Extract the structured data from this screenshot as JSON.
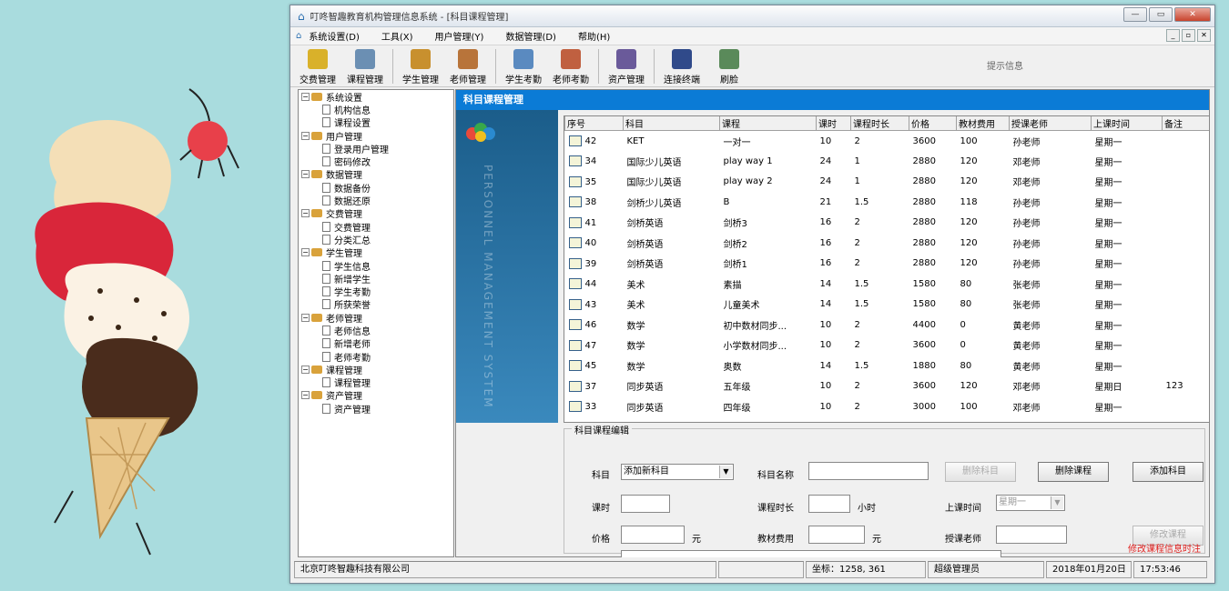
{
  "window": {
    "title": "叮咚智趣教育机构管理信息系统 - [科目课程管理]"
  },
  "menu": [
    "系统设置(D)",
    "工具(X)",
    "用户管理(Y)",
    "数据管理(D)",
    "帮助(H)"
  ],
  "toolbar": {
    "buttons": [
      {
        "label": "交费管理",
        "color": "#d9b12a"
      },
      {
        "label": "课程管理",
        "color": "#6b8fb3"
      },
      {
        "label": "学生管理",
        "color": "#c8902e"
      },
      {
        "label": "老师管理",
        "color": "#b8743a"
      },
      {
        "label": "学生考勤",
        "color": "#5a8ac0"
      },
      {
        "label": "老师考勤",
        "color": "#c06040"
      },
      {
        "label": "资产管理",
        "color": "#6a5a9a"
      },
      {
        "label": "连接终端",
        "color": "#304a8a"
      },
      {
        "label": "刷脸",
        "color": "#5a8a5a"
      }
    ],
    "tip": "提示信息"
  },
  "tree": [
    {
      "label": "系统设置",
      "children": [
        "机构信息",
        "课程设置"
      ]
    },
    {
      "label": "用户管理",
      "children": [
        "登录用户管理",
        "密码修改"
      ]
    },
    {
      "label": "数据管理",
      "children": [
        "数据备份",
        "数据还原"
      ]
    },
    {
      "label": "交费管理",
      "children": [
        "交费管理",
        "分类汇总"
      ]
    },
    {
      "label": "学生管理",
      "children": [
        "学生信息",
        "新增学生",
        "学生考勤",
        "所获荣誉"
      ]
    },
    {
      "label": "老师管理",
      "children": [
        "老师信息",
        "新增老师",
        "老师考勤"
      ]
    },
    {
      "label": "课程管理",
      "children": [
        "课程管理"
      ]
    },
    {
      "label": "资产管理",
      "children": [
        "资产管理"
      ]
    }
  ],
  "panel": {
    "title": "科目课程管理",
    "side_text": "PERSONNEL MANAGEMENT SYSTEM"
  },
  "table": {
    "columns": [
      "序号",
      "科目",
      "课程",
      "课时",
      "课程时长",
      "价格",
      "教材费用",
      "授课老师",
      "上课时间",
      "备注"
    ],
    "rows": [
      [
        "42",
        "KET",
        "一对一",
        "10",
        "2",
        "3600",
        "100",
        "孙老师",
        "星期一",
        ""
      ],
      [
        "34",
        "国际少儿英语",
        "play way 1",
        "24",
        "1",
        "2880",
        "120",
        "邓老师",
        "星期一",
        ""
      ],
      [
        "35",
        "国际少儿英语",
        "play way 2",
        "24",
        "1",
        "2880",
        "120",
        "邓老师",
        "星期一",
        ""
      ],
      [
        "38",
        "剑桥少儿英语",
        "B",
        "21",
        "1.5",
        "2880",
        "118",
        "孙老师",
        "星期一",
        ""
      ],
      [
        "41",
        "剑桥英语",
        "剑桥3",
        "16",
        "2",
        "2880",
        "120",
        "孙老师",
        "星期一",
        ""
      ],
      [
        "40",
        "剑桥英语",
        "剑桥2",
        "16",
        "2",
        "2880",
        "120",
        "孙老师",
        "星期一",
        ""
      ],
      [
        "39",
        "剑桥英语",
        "剑桥1",
        "16",
        "2",
        "2880",
        "120",
        "孙老师",
        "星期一",
        ""
      ],
      [
        "44",
        "美术",
        "素描",
        "14",
        "1.5",
        "1580",
        "80",
        "张老师",
        "星期一",
        ""
      ],
      [
        "43",
        "美术",
        "儿童美术",
        "14",
        "1.5",
        "1580",
        "80",
        "张老师",
        "星期一",
        ""
      ],
      [
        "46",
        "数学",
        "初中数材同步...",
        "10",
        "2",
        "4400",
        "0",
        "黄老师",
        "星期一",
        ""
      ],
      [
        "47",
        "数学",
        "小学数材同步...",
        "10",
        "2",
        "3600",
        "0",
        "黄老师",
        "星期一",
        ""
      ],
      [
        "45",
        "数学",
        "奥数",
        "14",
        "1.5",
        "1880",
        "80",
        "黄老师",
        "星期一",
        ""
      ],
      [
        "37",
        "同步英语",
        "五年级",
        "10",
        "2",
        "3600",
        "120",
        "邓老师",
        "星期日",
        "123"
      ],
      [
        "33",
        "同步英语",
        "四年级",
        "10",
        "2",
        "3000",
        "100",
        "邓老师",
        "星期一",
        ""
      ]
    ]
  },
  "edit": {
    "legend": "科目课程编辑",
    "subject_label": "科目",
    "subject_value": "添加新科目",
    "subject_name_label": "科目名称",
    "delete_subject": "删除科目",
    "delete_course": "删除课程",
    "add_subject": "添加科目",
    "hours_label": "课时",
    "duration_label": "课程时长",
    "duration_unit": "小时",
    "time_label": "上课时间",
    "time_value": "星期一",
    "price_label": "价格",
    "price_unit": "元",
    "material_label": "教材费用",
    "material_unit": "元",
    "teacher_label": "授课老师",
    "modify_course": "修改课程",
    "warning": "修改课程信息时注"
  },
  "status": {
    "company": "北京叮咚智趣科技有限公司",
    "coords": "坐标：1258, 361",
    "user": "超级管理员",
    "date": "2018年01月20日",
    "time": "17:53:46"
  }
}
